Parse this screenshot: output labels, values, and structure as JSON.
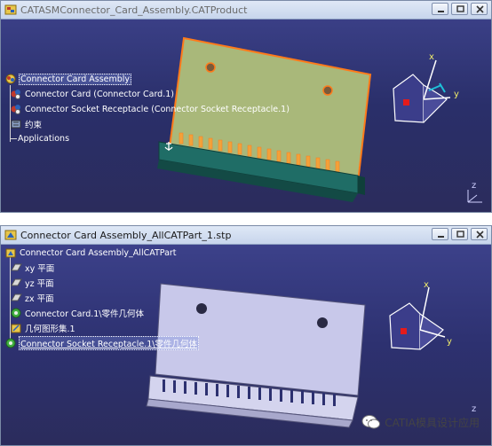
{
  "window_top": {
    "title": "CATASMConnector_Card_Assembly.CATProduct",
    "tree": {
      "root": "Connector Card Assembly",
      "items": [
        "Connector Card (Connector Card.1)",
        "Connector Socket Receptacle (Connector Socket Receptacle.1)",
        "约束",
        "Applications"
      ]
    },
    "compass": {
      "x_label": "x",
      "y_label": "y",
      "z_label": "z"
    }
  },
  "window_bottom": {
    "title": "Connector Card Assembly_AllCATPart_1.stp",
    "tree": {
      "root": "Connector Card Assembly_AllCATPart",
      "items": [
        "xy 平面",
        "yz 平面",
        "zx 平面",
        "Connector Card.1\\零件几何体",
        "几何图形集.1",
        "Connector Socket Receptacle.1\\零件几何体"
      ]
    },
    "compass": {
      "x_label": "x",
      "y_label": "y",
      "z_label": "z"
    }
  },
  "watermark": {
    "text": "CATIA模具设计应用"
  },
  "colors": {
    "viewport_bg": "#2f3470",
    "card_top": "#a9b87a",
    "card_highlight": "#ff7a1a",
    "socket_top": "#1f6d66",
    "part_gray": "#c8c8ea"
  }
}
